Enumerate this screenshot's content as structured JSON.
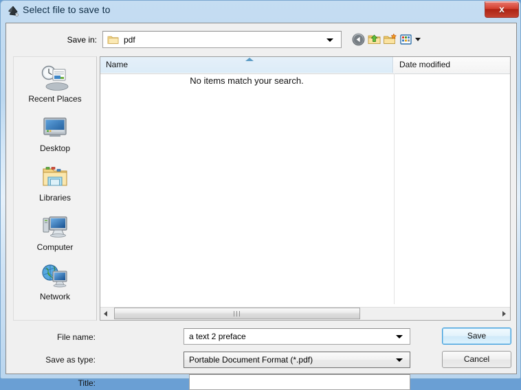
{
  "window": {
    "title": "Select file to save to",
    "app_icon": "inkscape-diamond-icon",
    "close_label": "x"
  },
  "toolbar": {
    "save_in_label": "Save in:",
    "current_folder": "pdf",
    "folder_icon": "folder-icon",
    "buttons": [
      {
        "name": "back-button",
        "icon": "back-arrow-icon"
      },
      {
        "name": "up-folder-button",
        "icon": "up-folder-icon"
      },
      {
        "name": "new-folder-button",
        "icon": "new-folder-icon"
      },
      {
        "name": "views-button",
        "icon": "views-grid-icon"
      }
    ]
  },
  "places": {
    "items": [
      {
        "label": "Recent Places",
        "icon": "recent-places-icon"
      },
      {
        "label": "Desktop",
        "icon": "desktop-monitor-icon"
      },
      {
        "label": "Libraries",
        "icon": "libraries-folder-icon"
      },
      {
        "label": "Computer",
        "icon": "computer-icon"
      },
      {
        "label": "Network",
        "icon": "network-globe-icon"
      }
    ]
  },
  "filelist": {
    "columns": [
      {
        "label": "Name",
        "sorted": "ascending"
      },
      {
        "label": "Date modified",
        "sorted": "none"
      }
    ],
    "rows": [],
    "empty_message": "No items match your search.",
    "scrollbar": {
      "orientation": "horizontal",
      "grip_icon": "grip-icon"
    }
  },
  "form": {
    "filename_label": "File name:",
    "filename_value": "a text 2 preface",
    "savetype_label": "Save as type:",
    "savetype_value": "Portable Document Format (*.pdf)",
    "title_label": "Title:",
    "title_value": "",
    "title_placeholder": ""
  },
  "actions": {
    "save_label": "Save",
    "cancel_label": "Cancel"
  },
  "colors": {
    "accent_blue": "#3c9ddd",
    "frame_blue": "#b9d5ee",
    "close_red": "#d23f2e",
    "header_highlight": "#dcecf8",
    "sort_marker": "#5b9bc4"
  }
}
